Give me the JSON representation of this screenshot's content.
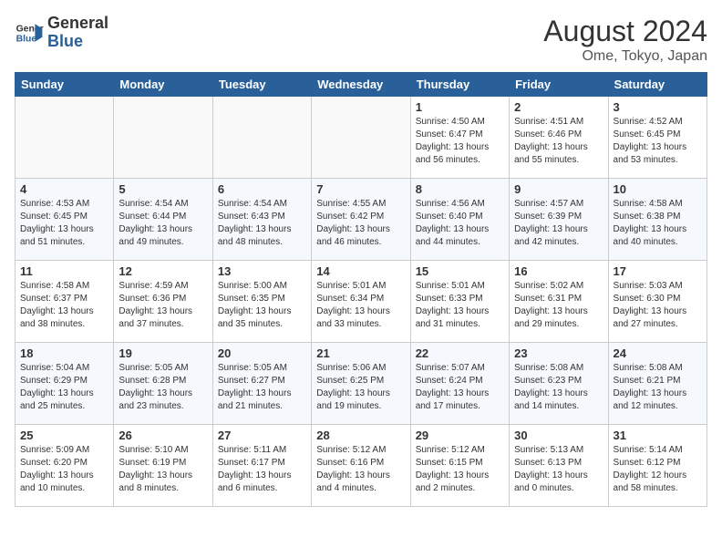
{
  "header": {
    "logo_line1": "General",
    "logo_line2": "Blue",
    "month_year": "August 2024",
    "location": "Ome, Tokyo, Japan"
  },
  "weekdays": [
    "Sunday",
    "Monday",
    "Tuesday",
    "Wednesday",
    "Thursday",
    "Friday",
    "Saturday"
  ],
  "weeks": [
    [
      {
        "day": "",
        "info": ""
      },
      {
        "day": "",
        "info": ""
      },
      {
        "day": "",
        "info": ""
      },
      {
        "day": "",
        "info": ""
      },
      {
        "day": "1",
        "info": "Sunrise: 4:50 AM\nSunset: 6:47 PM\nDaylight: 13 hours\nand 56 minutes."
      },
      {
        "day": "2",
        "info": "Sunrise: 4:51 AM\nSunset: 6:46 PM\nDaylight: 13 hours\nand 55 minutes."
      },
      {
        "day": "3",
        "info": "Sunrise: 4:52 AM\nSunset: 6:45 PM\nDaylight: 13 hours\nand 53 minutes."
      }
    ],
    [
      {
        "day": "4",
        "info": "Sunrise: 4:53 AM\nSunset: 6:45 PM\nDaylight: 13 hours\nand 51 minutes."
      },
      {
        "day": "5",
        "info": "Sunrise: 4:54 AM\nSunset: 6:44 PM\nDaylight: 13 hours\nand 49 minutes."
      },
      {
        "day": "6",
        "info": "Sunrise: 4:54 AM\nSunset: 6:43 PM\nDaylight: 13 hours\nand 48 minutes."
      },
      {
        "day": "7",
        "info": "Sunrise: 4:55 AM\nSunset: 6:42 PM\nDaylight: 13 hours\nand 46 minutes."
      },
      {
        "day": "8",
        "info": "Sunrise: 4:56 AM\nSunset: 6:40 PM\nDaylight: 13 hours\nand 44 minutes."
      },
      {
        "day": "9",
        "info": "Sunrise: 4:57 AM\nSunset: 6:39 PM\nDaylight: 13 hours\nand 42 minutes."
      },
      {
        "day": "10",
        "info": "Sunrise: 4:58 AM\nSunset: 6:38 PM\nDaylight: 13 hours\nand 40 minutes."
      }
    ],
    [
      {
        "day": "11",
        "info": "Sunrise: 4:58 AM\nSunset: 6:37 PM\nDaylight: 13 hours\nand 38 minutes."
      },
      {
        "day": "12",
        "info": "Sunrise: 4:59 AM\nSunset: 6:36 PM\nDaylight: 13 hours\nand 37 minutes."
      },
      {
        "day": "13",
        "info": "Sunrise: 5:00 AM\nSunset: 6:35 PM\nDaylight: 13 hours\nand 35 minutes."
      },
      {
        "day": "14",
        "info": "Sunrise: 5:01 AM\nSunset: 6:34 PM\nDaylight: 13 hours\nand 33 minutes."
      },
      {
        "day": "15",
        "info": "Sunrise: 5:01 AM\nSunset: 6:33 PM\nDaylight: 13 hours\nand 31 minutes."
      },
      {
        "day": "16",
        "info": "Sunrise: 5:02 AM\nSunset: 6:31 PM\nDaylight: 13 hours\nand 29 minutes."
      },
      {
        "day": "17",
        "info": "Sunrise: 5:03 AM\nSunset: 6:30 PM\nDaylight: 13 hours\nand 27 minutes."
      }
    ],
    [
      {
        "day": "18",
        "info": "Sunrise: 5:04 AM\nSunset: 6:29 PM\nDaylight: 13 hours\nand 25 minutes."
      },
      {
        "day": "19",
        "info": "Sunrise: 5:05 AM\nSunset: 6:28 PM\nDaylight: 13 hours\nand 23 minutes."
      },
      {
        "day": "20",
        "info": "Sunrise: 5:05 AM\nSunset: 6:27 PM\nDaylight: 13 hours\nand 21 minutes."
      },
      {
        "day": "21",
        "info": "Sunrise: 5:06 AM\nSunset: 6:25 PM\nDaylight: 13 hours\nand 19 minutes."
      },
      {
        "day": "22",
        "info": "Sunrise: 5:07 AM\nSunset: 6:24 PM\nDaylight: 13 hours\nand 17 minutes."
      },
      {
        "day": "23",
        "info": "Sunrise: 5:08 AM\nSunset: 6:23 PM\nDaylight: 13 hours\nand 14 minutes."
      },
      {
        "day": "24",
        "info": "Sunrise: 5:08 AM\nSunset: 6:21 PM\nDaylight: 13 hours\nand 12 minutes."
      }
    ],
    [
      {
        "day": "25",
        "info": "Sunrise: 5:09 AM\nSunset: 6:20 PM\nDaylight: 13 hours\nand 10 minutes."
      },
      {
        "day": "26",
        "info": "Sunrise: 5:10 AM\nSunset: 6:19 PM\nDaylight: 13 hours\nand 8 minutes."
      },
      {
        "day": "27",
        "info": "Sunrise: 5:11 AM\nSunset: 6:17 PM\nDaylight: 13 hours\nand 6 minutes."
      },
      {
        "day": "28",
        "info": "Sunrise: 5:12 AM\nSunset: 6:16 PM\nDaylight: 13 hours\nand 4 minutes."
      },
      {
        "day": "29",
        "info": "Sunrise: 5:12 AM\nSunset: 6:15 PM\nDaylight: 13 hours\nand 2 minutes."
      },
      {
        "day": "30",
        "info": "Sunrise: 5:13 AM\nSunset: 6:13 PM\nDaylight: 13 hours\nand 0 minutes."
      },
      {
        "day": "31",
        "info": "Sunrise: 5:14 AM\nSunset: 6:12 PM\nDaylight: 12 hours\nand 58 minutes."
      }
    ]
  ]
}
